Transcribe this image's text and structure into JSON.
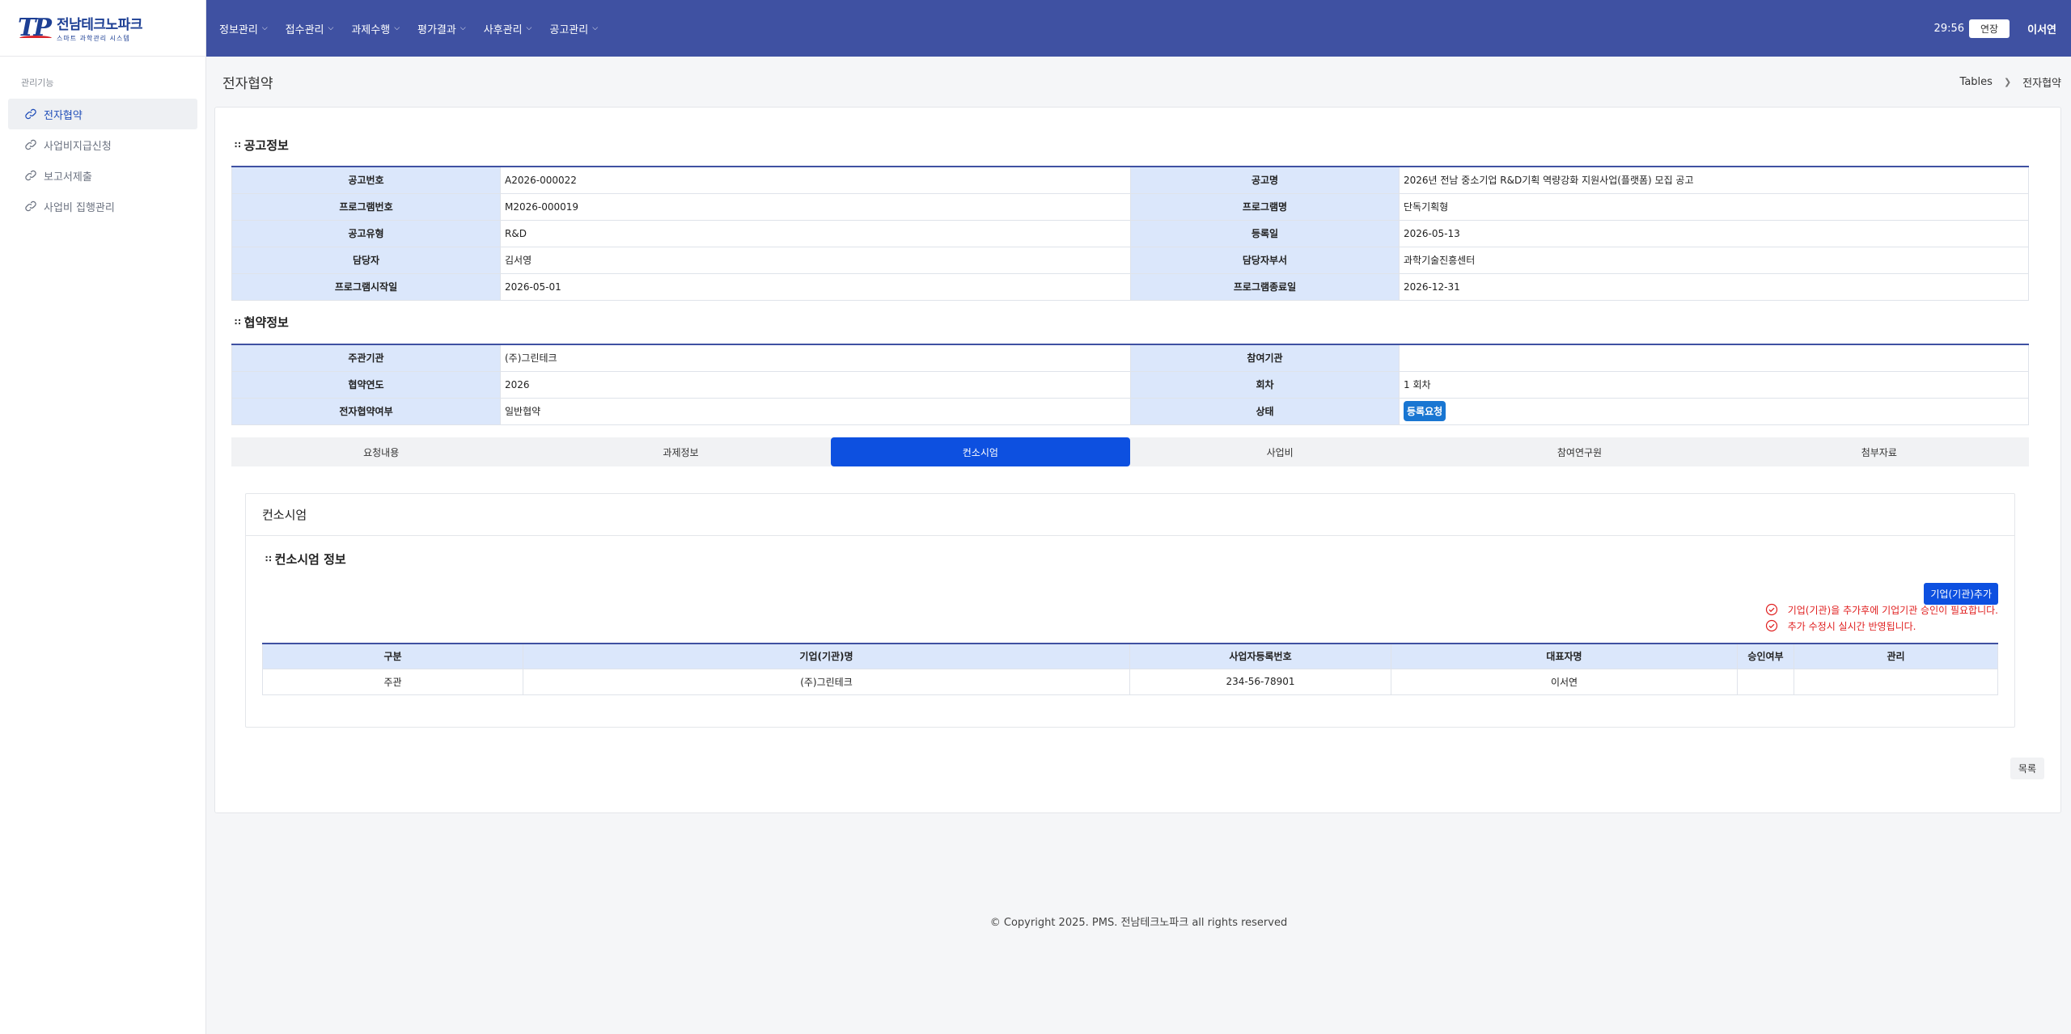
{
  "logo": {
    "mark": "TP",
    "name": "전남테크노파크",
    "sub": "스마트 과학관리 시스템"
  },
  "sidebar": {
    "section_label": "관리기능",
    "items": [
      {
        "label": "전자협약",
        "icon": "link-icon",
        "active": true
      },
      {
        "label": "사업비지급신청",
        "icon": "link-icon",
        "active": false
      },
      {
        "label": "보고서제출",
        "icon": "link-icon",
        "active": false
      },
      {
        "label": "사업비 집행관리",
        "icon": "link-icon",
        "active": false
      }
    ]
  },
  "topnav": {
    "items": [
      "정보관리",
      "접수관리",
      "과제수행",
      "평가결과",
      "사후관리",
      "공고관리"
    ],
    "timer": "29:56",
    "extend_label": "연장",
    "user": "이서연"
  },
  "page": {
    "title": "전자협약",
    "breadcrumb": [
      "Tables",
      "전자협약"
    ]
  },
  "announcement": {
    "title": "공고정보",
    "rows": [
      {
        "k1": "공고번호",
        "v1": "A2026-000022",
        "k2": "공고명",
        "v2": "2026년 전남 중소기업 R&D기획 역량강화 지원사업(플랫폼) 모집 공고"
      },
      {
        "k1": "프로그램번호",
        "v1": "M2026-000019",
        "k2": "프로그램명",
        "v2": "단독기획형"
      },
      {
        "k1": "공고유형",
        "v1": "R&D",
        "k2": "등록일",
        "v2": "2026-05-13"
      },
      {
        "k1": "담당자",
        "v1": "김서영",
        "k2": "담당자부서",
        "v2": "과학기술진흥센터"
      },
      {
        "k1": "프로그램시작일",
        "v1": "2026-05-01",
        "k2": "프로그램종료일",
        "v2": "2026-12-31"
      }
    ]
  },
  "agreement": {
    "title": "협약정보",
    "rows": [
      {
        "k1": "주관기관",
        "v1": "(주)그린테크",
        "k2": "참여기관",
        "v2": ""
      },
      {
        "k1": "협약연도",
        "v1": "2026",
        "k2": "회차",
        "v2": "1 회차"
      },
      {
        "k1": "전자협약여부",
        "v1": "일반협약",
        "k2": "상태",
        "v2": ""
      }
    ],
    "status_badge": "등록요청"
  },
  "tabs": [
    {
      "label": "요청내용",
      "active": false
    },
    {
      "label": "과제정보",
      "active": false
    },
    {
      "label": "컨소시엄",
      "active": true
    },
    {
      "label": "사업비",
      "active": false
    },
    {
      "label": "참여연구원",
      "active": false
    },
    {
      "label": "첨부자료",
      "active": false
    }
  ],
  "consortium": {
    "panel_title": "컨소시엄",
    "section_title": "컨소시엄 정보",
    "add_button": "기업(기관)추가",
    "notes": [
      "기업(기관)을 추가후에 기업기관 승인이 필요합니다.",
      "추가 수정시 실시간 반영됩니다."
    ],
    "columns": [
      "구분",
      "기업(기관)명",
      "사업자등록번호",
      "대표자명",
      "승인여부",
      "관리"
    ],
    "rows": [
      [
        "주관",
        "(주)그린테크",
        "234-56-78901",
        "이서연",
        "",
        ""
      ]
    ]
  },
  "list_button": "목록",
  "footer": "© Copyright 2025. PMS. 전남테크노파크 all rights reserved",
  "colors": {
    "topbar": "#3f51a2",
    "accent": "#0d50e0",
    "header_cell": "#dbe7fb",
    "note_red": "#e02020"
  }
}
